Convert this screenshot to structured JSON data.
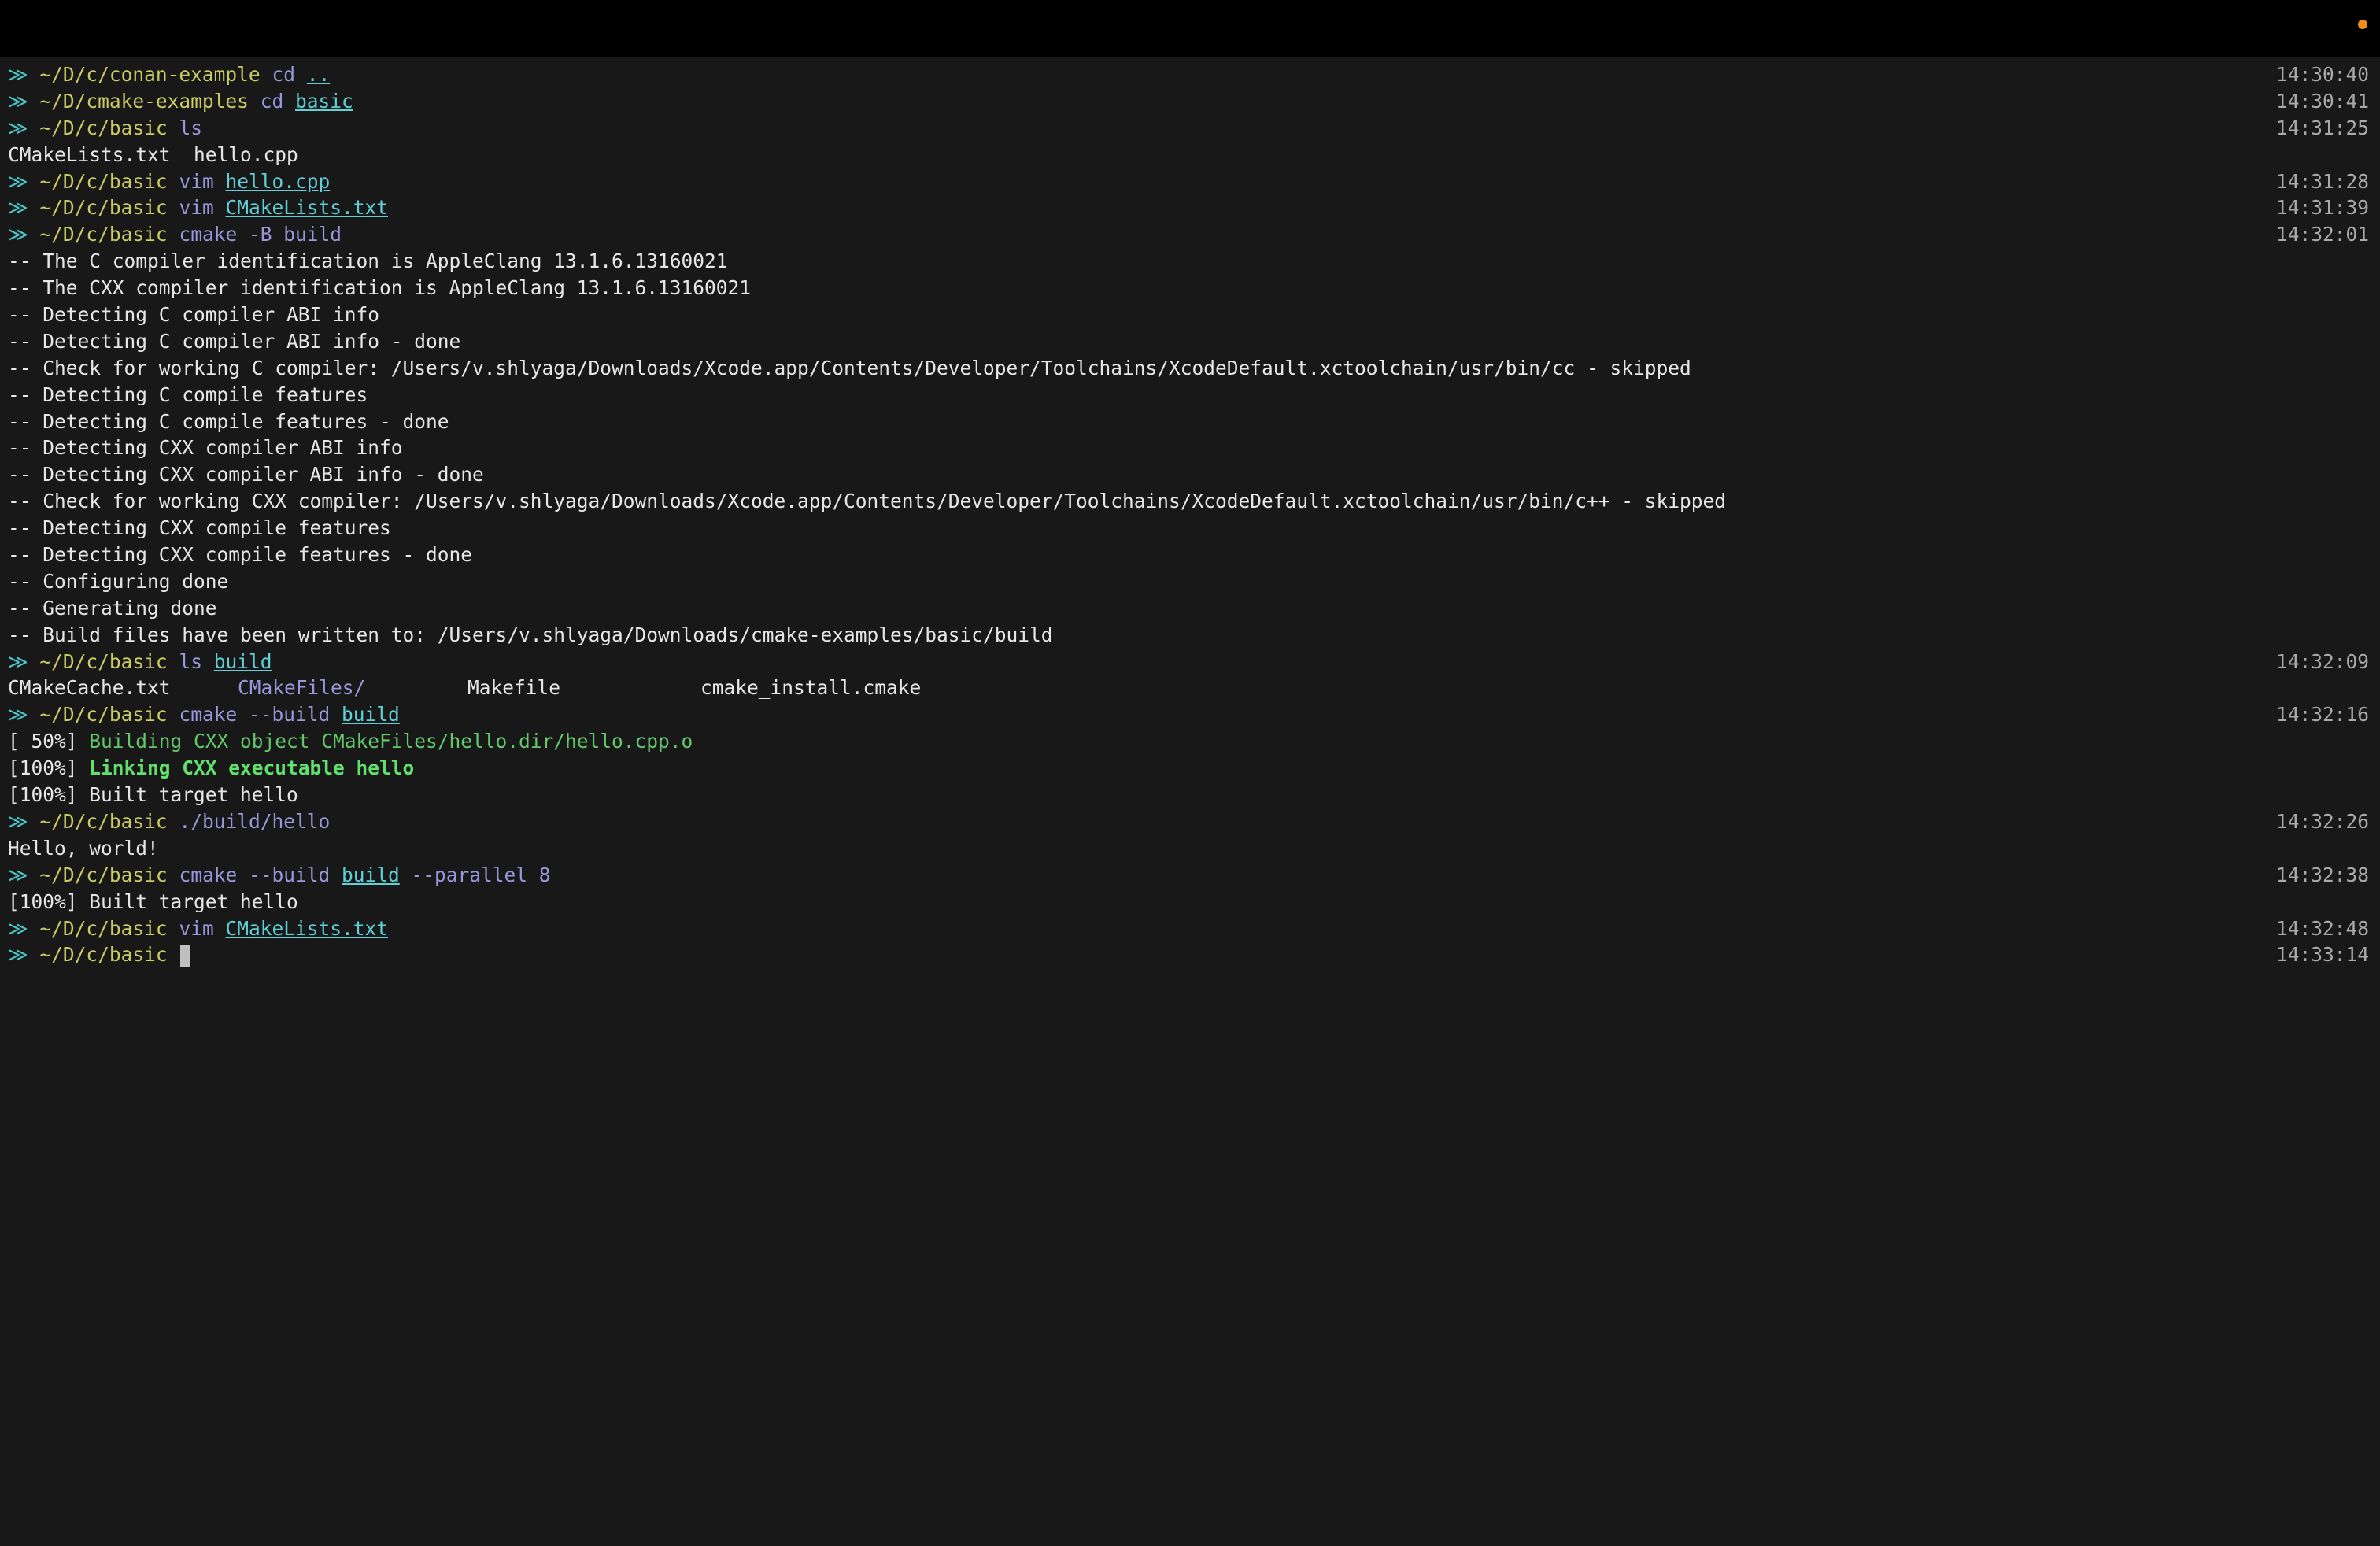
{
  "colors": {
    "background": "#181818",
    "titlebar": "#000000",
    "status_dot": "#f28c1a",
    "prompt_path": "#cbcb63",
    "command": "#9a96db",
    "file_arg": "#5fd0d6",
    "build_green": "#62c96b",
    "timestamp": "#a9a9a9"
  },
  "prompt_symbol": "≫",
  "lines": [
    {
      "path": "~/D/c/conan-example",
      "cmd": "cd",
      "arg": "..",
      "ts": "14:30:40"
    },
    {
      "path": "~/D/cmake-examples",
      "cmd": "cd",
      "arg": "basic",
      "ts": "14:30:41"
    },
    {
      "path": "~/D/c/basic",
      "cmd": "ls",
      "ts": "14:31:25"
    },
    {
      "text": "CMakeLists.txt  hello.cpp"
    },
    {
      "path": "~/D/c/basic",
      "cmd": "vim",
      "arg": "hello.cpp",
      "ts": "14:31:28"
    },
    {
      "path": "~/D/c/basic",
      "cmd": "vim",
      "arg": "CMakeLists.txt",
      "ts": "14:31:39"
    },
    {
      "path": "~/D/c/basic",
      "cmd": "cmake -B build",
      "ts": "14:32:01"
    },
    {
      "text": "-- The C compiler identification is AppleClang 13.1.6.13160021"
    },
    {
      "text": "-- The CXX compiler identification is AppleClang 13.1.6.13160021"
    },
    {
      "text": "-- Detecting C compiler ABI info"
    },
    {
      "text": "-- Detecting C compiler ABI info - done"
    },
    {
      "text": "-- Check for working C compiler: /Users/v.shlyaga/Downloads/Xcode.app/Contents/Developer/Toolchains/XcodeDefault.xctoolchain/usr/bin/cc - skipped"
    },
    {
      "text": "-- Detecting C compile features"
    },
    {
      "text": "-- Detecting C compile features - done"
    },
    {
      "text": "-- Detecting CXX compiler ABI info"
    },
    {
      "text": "-- Detecting CXX compiler ABI info - done"
    },
    {
      "text": "-- Check for working CXX compiler: /Users/v.shlyaga/Downloads/Xcode.app/Contents/Developer/Toolchains/XcodeDefault.xctoolchain/usr/bin/c++ - skipped"
    },
    {
      "text": "-- Detecting CXX compile features"
    },
    {
      "text": "-- Detecting CXX compile features - done"
    },
    {
      "text": "-- Configuring done"
    },
    {
      "text": "-- Generating done"
    },
    {
      "text": "-- Build files have been written to: /Users/v.shlyaga/Downloads/cmake-examples/basic/build"
    },
    {
      "path": "~/D/c/basic",
      "cmd": "ls",
      "arg": "build",
      "ts": "14:32:09"
    },
    {
      "ls": [
        "CMakeCache.txt",
        "CMakeFiles/",
        "Makefile",
        "cmake_install.cmake"
      ]
    },
    {
      "path": "~/D/c/basic",
      "cmd": "cmake --build",
      "arg": "build",
      "ts": "14:32:16"
    },
    {
      "progress": "[ 50%]",
      "msg": "Building CXX object CMakeFiles/hello.dir/hello.cpp.o",
      "style": "green"
    },
    {
      "progress": "[100%]",
      "msg": "Linking CXX executable hello",
      "style": "green-bold"
    },
    {
      "progress": "[100%]",
      "msg": "Built target hello",
      "style": "white"
    },
    {
      "path": "~/D/c/basic",
      "cmd": "./build/hello",
      "ts": "14:32:26"
    },
    {
      "text": "Hello, world!"
    },
    {
      "path": "~/D/c/basic",
      "cmd": "cmake --build",
      "arg": "build",
      "rest": "--parallel 8",
      "ts": "14:32:38"
    },
    {
      "progress": "[100%]",
      "msg": "Built target hello",
      "style": "white"
    },
    {
      "path": "~/D/c/basic",
      "cmd": "vim",
      "arg": "CMakeLists.txt",
      "ts": "14:32:48"
    },
    {
      "path": "~/D/c/basic",
      "cursor": true,
      "ts": "14:33:14"
    }
  ]
}
